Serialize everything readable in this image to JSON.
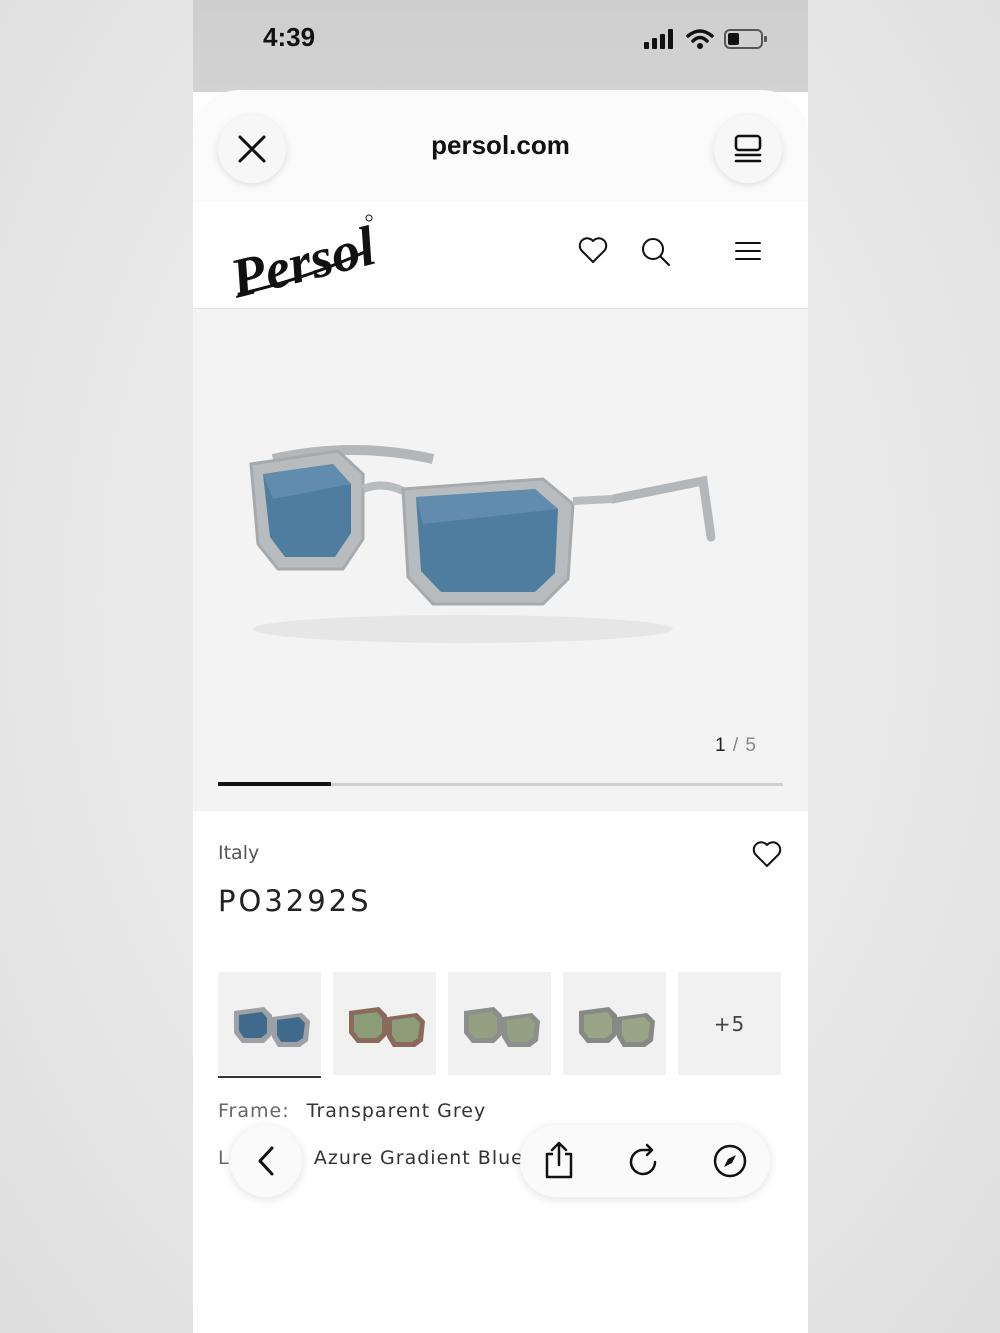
{
  "status_bar": {
    "time": "4:39"
  },
  "browser": {
    "url": "persol.com"
  },
  "site": {
    "brand": "Persol"
  },
  "gallery": {
    "current": "1",
    "separator": "/",
    "total": "5",
    "progress": 0.2
  },
  "product": {
    "origin": "Italy",
    "model": "PO3292S",
    "variants": [
      {
        "tint": "blue",
        "selected": true
      },
      {
        "tint": "havana-green",
        "selected": false
      },
      {
        "tint": "grey-green",
        "selected": false
      },
      {
        "tint": "grey-green",
        "selected": false
      }
    ],
    "more_variants": "+5",
    "frame_label": "Frame:",
    "frame_value": "Transparent Grey",
    "lenses_label": "Lenses:",
    "lenses_value": "Azure Gradient Blue"
  },
  "colors": {
    "text": "#222222",
    "muted": "#666666",
    "lens_blue": "#4f7da0",
    "frame_grey": "#b9bcbf"
  },
  "icons": [
    "close-icon",
    "tab-overview-icon",
    "heart-icon",
    "search-icon",
    "menu-icon",
    "back-icon",
    "share-icon",
    "reload-icon",
    "compass-icon"
  ]
}
